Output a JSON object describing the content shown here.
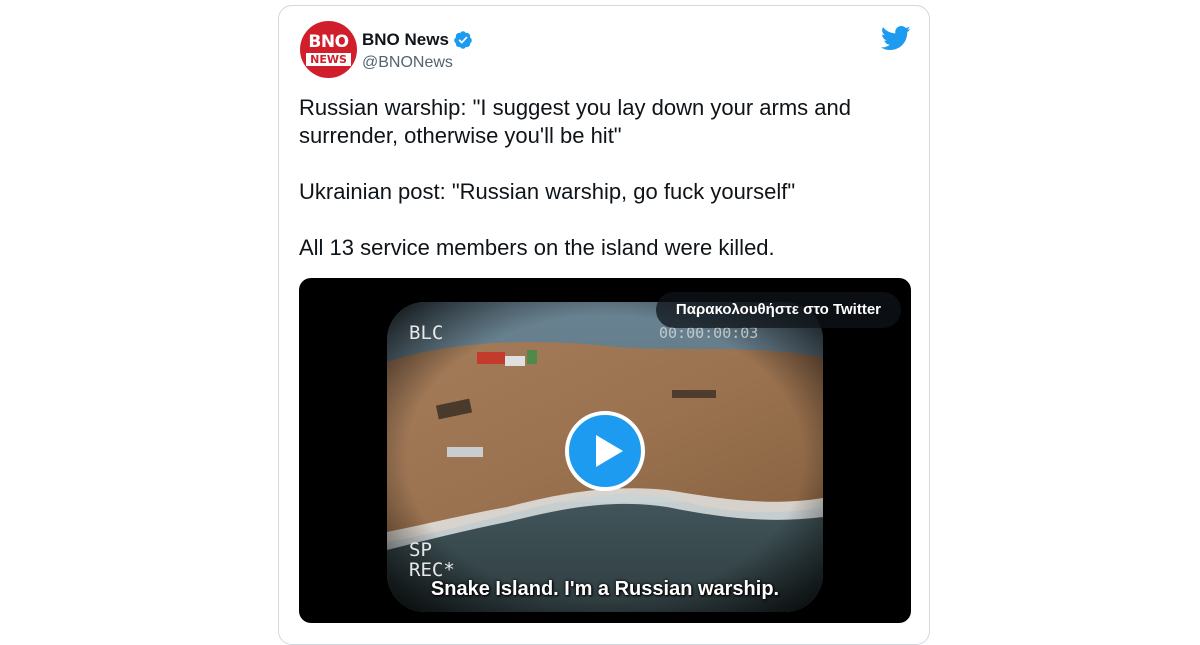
{
  "author": {
    "avatar_text_top": "BNO",
    "avatar_text_bottom": "NEWS",
    "name": "BNO News",
    "handle": "@BNONews"
  },
  "tweet": {
    "paragraphs": [
      "Russian warship: \"I suggest you lay down your arms and surrender, otherwise you'll be hit\"",
      "Ukrainian post: \"Russian warship, go fuck yourself\"",
      "All 13 service members on the island were killed."
    ]
  },
  "media": {
    "watch_label": "Παρακολουθήστε στο Twitter",
    "osd_top_left": "BLC",
    "osd_top_right": "00:00:00:03",
    "osd_bottom_line1": "SP",
    "osd_bottom_line2": "REC*",
    "subtitle": "Snake Island. I'm a Russian warship."
  },
  "icons": {
    "bird": "twitter-bird-icon",
    "verified": "verified-badge-icon",
    "play": "play-icon"
  },
  "colors": {
    "twitter_blue": "#1d9bf0",
    "avatar_red": "#d01f2b",
    "text": "#0f1419",
    "secondary_text": "#536471"
  }
}
